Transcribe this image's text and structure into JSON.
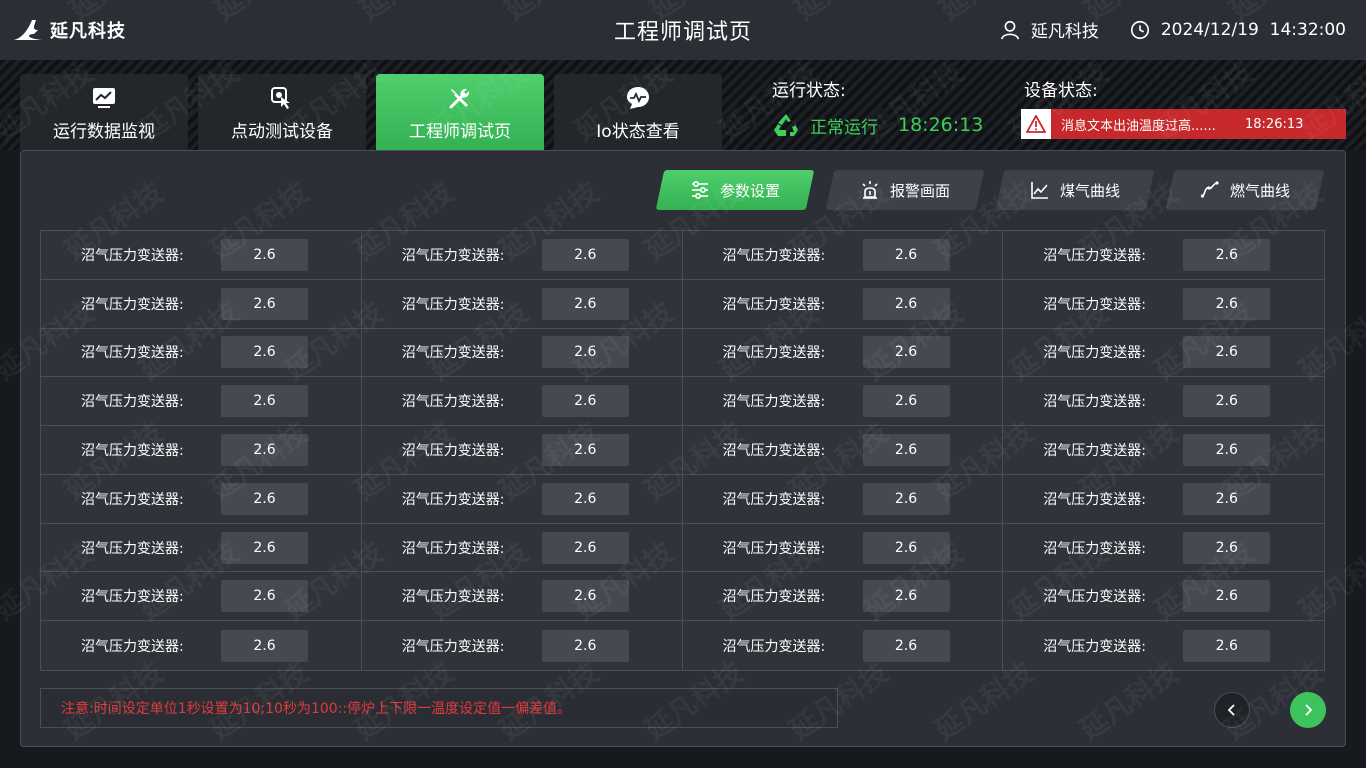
{
  "header": {
    "logo_text": "延凡科技",
    "title": "工程师调试页",
    "user_name": "延凡科技",
    "datetime": "2024/12/19  14:32:00"
  },
  "tabs": [
    {
      "label": "运行数据监视",
      "icon": "monitor-chart-icon",
      "active": false
    },
    {
      "label": "点动测试设备",
      "icon": "touch-test-icon",
      "active": false
    },
    {
      "label": "工程师调试页",
      "icon": "tools-icon",
      "active": true
    },
    {
      "label": "Io状态查看",
      "icon": "pulse-chat-icon",
      "active": false
    }
  ],
  "run_status": {
    "title": "运行状态:",
    "text": "正常运行",
    "time": "18:26:13"
  },
  "device_status": {
    "title": "设备状态:",
    "alarm_text": "消息文本出油温度过高......",
    "alarm_time": "18:26:13"
  },
  "subtabs": [
    {
      "label": "参数设置",
      "icon": "sliders-icon",
      "active": true
    },
    {
      "label": "报警画面",
      "icon": "alarm-light-icon",
      "active": false
    },
    {
      "label": "煤气曲线",
      "icon": "line-chart-icon",
      "active": false
    },
    {
      "label": "燃气曲线",
      "icon": "curve-icon",
      "active": false
    }
  ],
  "params": {
    "rows": [
      [
        {
          "label": "沼气压力变送器:",
          "value": "2.6"
        },
        {
          "label": "沼气压力变送器:",
          "value": "2.6"
        },
        {
          "label": "沼气压力变送器:",
          "value": "2.6"
        },
        {
          "label": "沼气压力变送器:",
          "value": "2.6"
        }
      ],
      [
        {
          "label": "沼气压力变送器:",
          "value": "2.6"
        },
        {
          "label": "沼气压力变送器:",
          "value": "2.6"
        },
        {
          "label": "沼气压力变送器:",
          "value": "2.6"
        },
        {
          "label": "沼气压力变送器:",
          "value": "2.6"
        }
      ],
      [
        {
          "label": "沼气压力变送器:",
          "value": "2.6"
        },
        {
          "label": "沼气压力变送器:",
          "value": "2.6"
        },
        {
          "label": "沼气压力变送器:",
          "value": "2.6"
        },
        {
          "label": "沼气压力变送器:",
          "value": "2.6"
        }
      ],
      [
        {
          "label": "沼气压力变送器:",
          "value": "2.6"
        },
        {
          "label": "沼气压力变送器:",
          "value": "2.6"
        },
        {
          "label": "沼气压力变送器:",
          "value": "2.6"
        },
        {
          "label": "沼气压力变送器:",
          "value": "2.6"
        }
      ],
      [
        {
          "label": "沼气压力变送器:",
          "value": "2.6"
        },
        {
          "label": "沼气压力变送器:",
          "value": "2.6"
        },
        {
          "label": "沼气压力变送器:",
          "value": "2.6"
        },
        {
          "label": "沼气压力变送器:",
          "value": "2.6"
        }
      ],
      [
        {
          "label": "沼气压力变送器:",
          "value": "2.6"
        },
        {
          "label": "沼气压力变送器:",
          "value": "2.6"
        },
        {
          "label": "沼气压力变送器:",
          "value": "2.6"
        },
        {
          "label": "沼气压力变送器:",
          "value": "2.6"
        }
      ],
      [
        {
          "label": "沼气压力变送器:",
          "value": "2.6"
        },
        {
          "label": "沼气压力变送器:",
          "value": "2.6"
        },
        {
          "label": "沼气压力变送器:",
          "value": "2.6"
        },
        {
          "label": "沼气压力变送器:",
          "value": "2.6"
        }
      ],
      [
        {
          "label": "沼气压力变送器:",
          "value": "2.6"
        },
        {
          "label": "沼气压力变送器:",
          "value": "2.6"
        },
        {
          "label": "沼气压力变送器:",
          "value": "2.6"
        },
        {
          "label": "沼气压力变送器:",
          "value": "2.6"
        }
      ],
      [
        {
          "label": "沼气压力变送器:",
          "value": "2.6"
        },
        {
          "label": "沼气压力变送器:",
          "value": "2.6"
        },
        {
          "label": "沼气压力变送器:",
          "value": "2.6"
        },
        {
          "label": "沼气压力变送器:",
          "value": "2.6"
        }
      ]
    ]
  },
  "note": "注意:时间设定单位1秒设置为10;10秒为100::停炉上下限一温度设定值一偏差值。",
  "watermark": "延凡科技",
  "colors": {
    "accent_green": "#3ecf5a",
    "alarm_red": "#c7282b",
    "note_red": "#e0393b",
    "background": "#16191d",
    "panel": "#2c3036"
  }
}
